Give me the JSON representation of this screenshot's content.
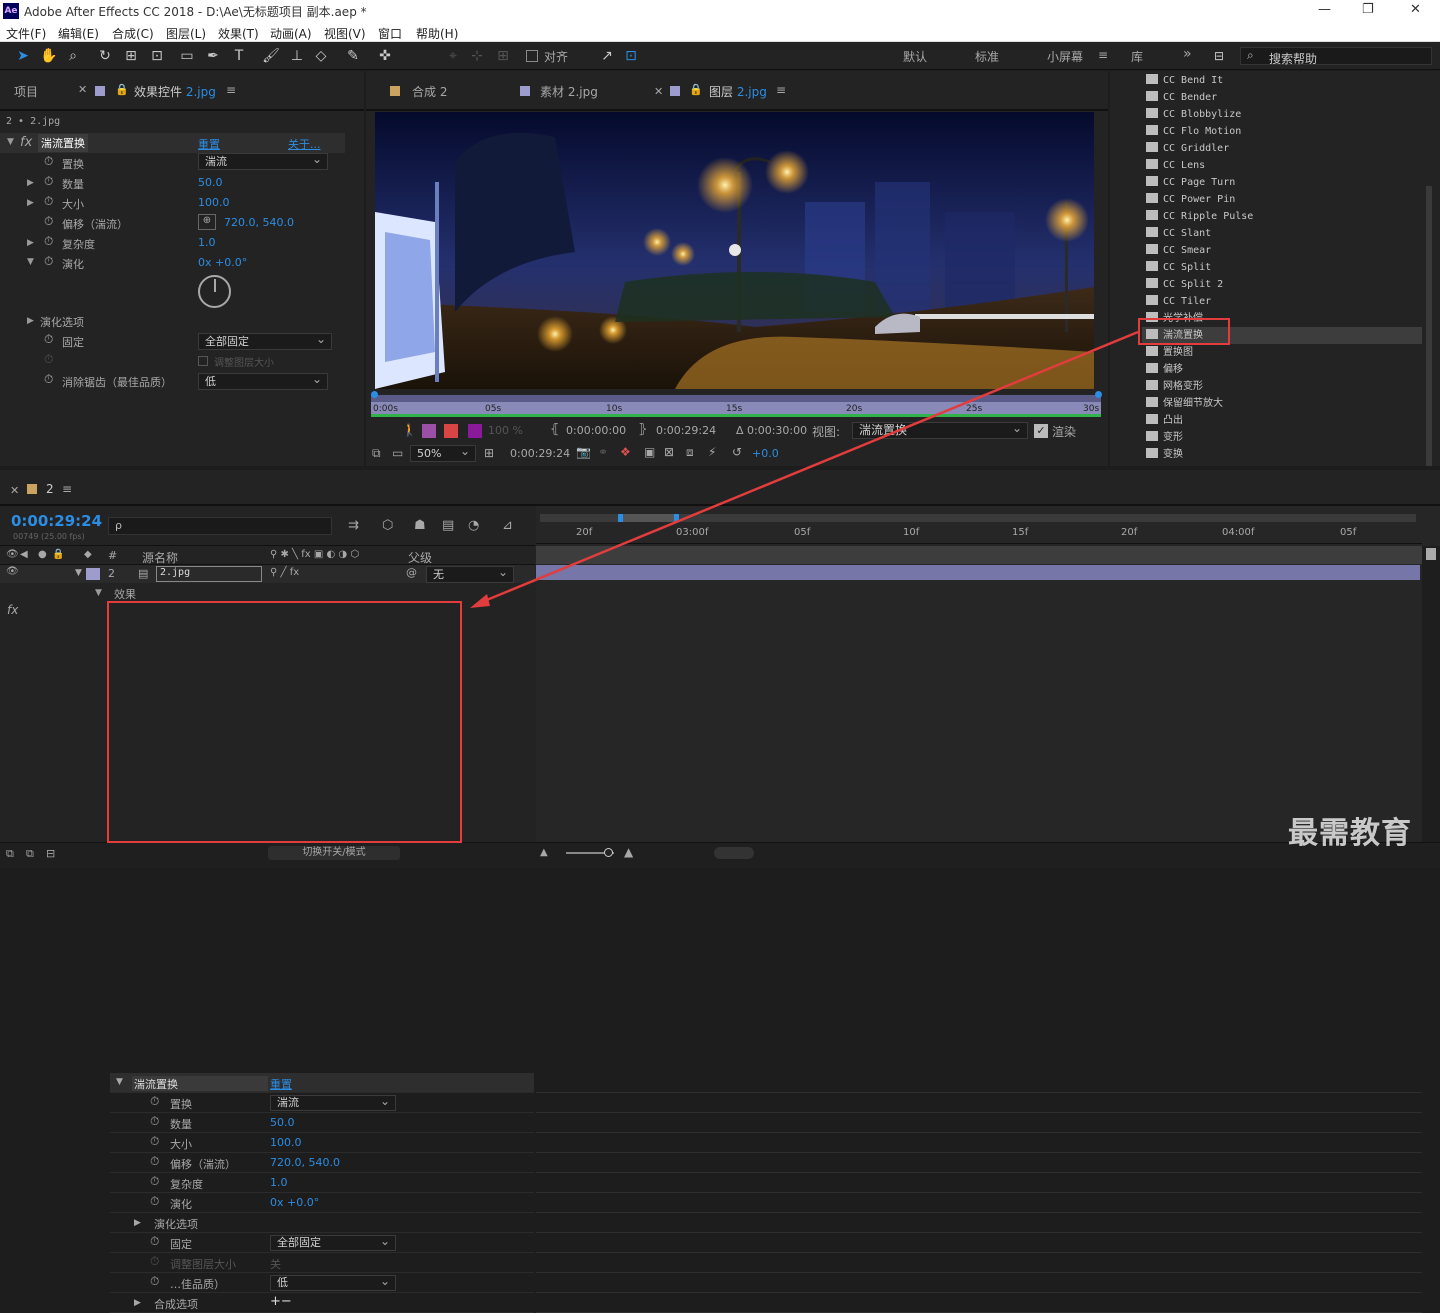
{
  "window": {
    "logo": "Ae",
    "title": "Adobe After Effects CC 2018 - D:\\Ae\\无标题项目 副本.aep *",
    "min": "—",
    "max": "❐",
    "close": "✕"
  },
  "menu": [
    "文件(F)",
    "编辑(E)",
    "合成(C)",
    "图层(L)",
    "效果(T)",
    "动画(A)",
    "视图(V)",
    "窗口",
    "帮助(H)"
  ],
  "toolbar": {
    "snap_label": "对齐",
    "workspaces": [
      "默认",
      "标准",
      "小屏幕",
      "库"
    ],
    "active_workspace": "小屏幕",
    "more": "»",
    "search_placeholder": "搜索帮助"
  },
  "project_panel": {
    "tab_project": "项目",
    "tab_effects": "效果控件",
    "tab_effects_layer": "2.jpg",
    "breadcrumb": "2 • 2.jpg",
    "effect_name": "湍流置换",
    "reset": "重置",
    "about": "关于...",
    "props": [
      {
        "name": "置换",
        "value": "湍流",
        "type": "dropdown"
      },
      {
        "name": "数量",
        "value": "50.0"
      },
      {
        "name": "大小",
        "value": "100.0"
      },
      {
        "name": "偏移（湍流）",
        "value": "720.0, 540.0"
      },
      {
        "name": "复杂度",
        "value": "1.0"
      },
      {
        "name": "演化",
        "value": "0x +0.0°"
      }
    ],
    "evolution_options": "演化选项",
    "pin": {
      "name": "固定",
      "value": "全部固定"
    },
    "resize": "调整图层大小",
    "antialias": {
      "name": "消除锯齿（最佳品质）",
      "value": "低"
    }
  },
  "viewer": {
    "tab_comp": "合成 2",
    "tab_footage": "素材 2.jpg",
    "tab_layer": "图层",
    "tab_layer_name": "2.jpg",
    "ruler": [
      "0:00s",
      "05s",
      "10s",
      "15s",
      "20s",
      "25s",
      "30s"
    ],
    "opacity": "100 %",
    "in_time": "0:00:00:00",
    "out_time": "0:00:29:24",
    "duration": "Δ 0:00:30:00",
    "view_label": "视图:",
    "view_value": "湍流置换",
    "render_label": "渲染",
    "zoom": "50%",
    "current_time": "0:00:29:24",
    "exposure": "+0.0"
  },
  "effects_list": {
    "items": [
      "CC Bend It",
      "CC Bender",
      "CC Blobbylize",
      "CC Flo Motion",
      "CC Griddler",
      "CC Lens",
      "CC Page Turn",
      "CC Power Pin",
      "CC Ripple Pulse",
      "CC Slant",
      "CC Smear",
      "CC Split",
      "CC Split 2",
      "CC Tiler",
      "光学补偿",
      "湍流置换",
      "置换图",
      "偏移",
      "网格变形",
      "保留细节放大",
      "凸出",
      "变形",
      "变换"
    ],
    "selected": "湍流置换"
  },
  "timeline": {
    "comp_tab": "2",
    "timecode": "0:00:29:24",
    "frames": "00749 (25.00 fps)",
    "search_icon": "ρ",
    "col_num": "#",
    "col_source": "源名称",
    "col_parent": "父级",
    "layer": {
      "index": "2",
      "name": "2.jpg",
      "parent": "无"
    },
    "effects_group": "效果",
    "fx_label": "fx",
    "effect_name": "湍流置换",
    "reset": "重置",
    "props": [
      {
        "name": "置换",
        "value": "湍流",
        "type": "dropdown"
      },
      {
        "name": "数量",
        "value": "50.0"
      },
      {
        "name": "大小",
        "value": "100.0"
      },
      {
        "name": "偏移（湍流）",
        "value": "720.0, 540.0"
      },
      {
        "name": "复杂度",
        "value": "1.0"
      },
      {
        "name": "演化",
        "value": "0x +0.0°"
      }
    ],
    "evolution_options": "演化选项",
    "pin": {
      "name": "固定",
      "value": "全部固定"
    },
    "resize": {
      "name": "调整图层大小",
      "value": "关"
    },
    "antialias": {
      "name": "…佳品质）",
      "value": "低"
    },
    "comp_options": "合成选项",
    "comp_options_value": "+−",
    "ruler": [
      "20f",
      "03:00f",
      "05f",
      "10f",
      "15f",
      "20f",
      "04:00f",
      "05f"
    ],
    "toggle_label": "切换开关/模式"
  },
  "watermark": "最需教育",
  "colors": {
    "accent": "#2b8de3",
    "highlight": "#e23c3c",
    "panel": "#232323",
    "layerbar": "#7676a8"
  }
}
